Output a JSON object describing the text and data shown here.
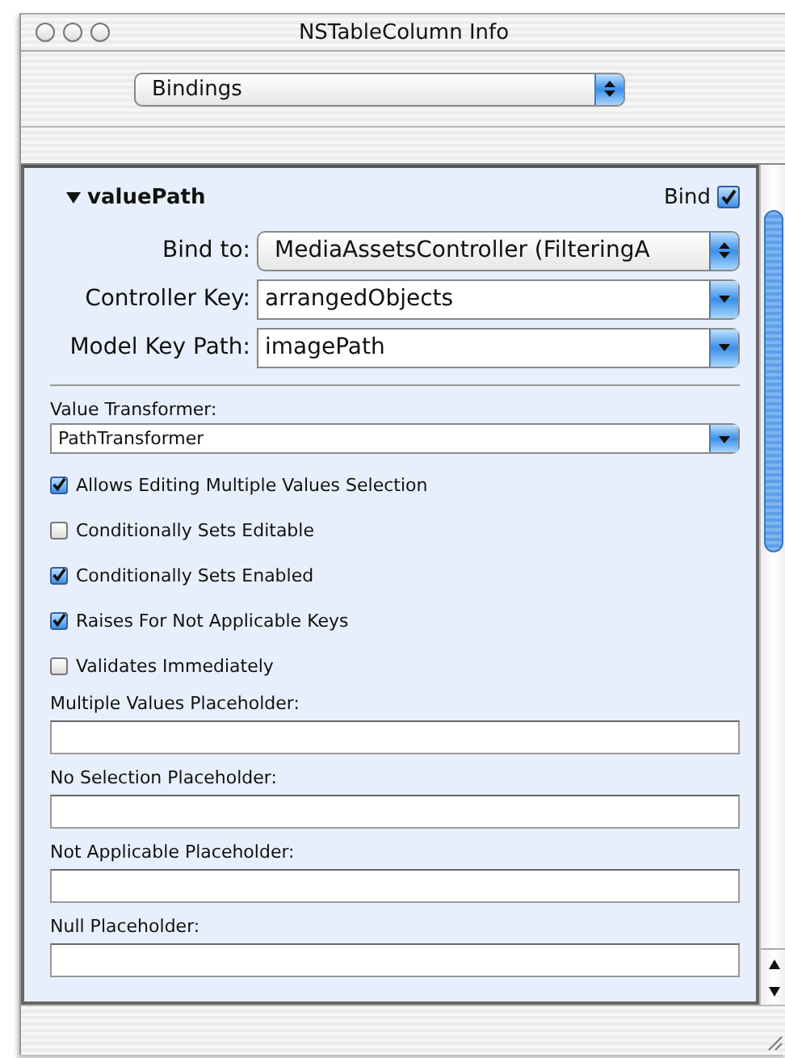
{
  "window": {
    "title": "NSTableColumn Info"
  },
  "inspector_popup": {
    "value": "Bindings"
  },
  "binding": {
    "name": "valuePath",
    "expanded": true,
    "bind_label": "Bind",
    "bind_checked": true,
    "rows": [
      {
        "kind": "popup",
        "label": "Bind to:",
        "value": "MediaAssetsController (FilteringA"
      },
      {
        "kind": "combo",
        "label": "Controller Key:",
        "value": "arrangedObjects"
      },
      {
        "kind": "combo",
        "label": "Model Key Path:",
        "value": "imagePath"
      }
    ],
    "value_transformer": {
      "label": "Value Transformer:",
      "value": "PathTransformer"
    },
    "options": [
      {
        "label": "Allows Editing Multiple Values Selection",
        "checked": true
      },
      {
        "label": "Conditionally Sets Editable",
        "checked": false
      },
      {
        "label": "Conditionally Sets Enabled",
        "checked": true
      },
      {
        "label": "Raises For Not Applicable Keys",
        "checked": true
      },
      {
        "label": "Validates Immediately",
        "checked": false
      }
    ],
    "placeholders": [
      {
        "label": "Multiple Values Placeholder:"
      },
      {
        "label": "No Selection Placeholder:"
      },
      {
        "label": "Not Applicable Placeholder:"
      },
      {
        "label": "Null Placeholder:"
      }
    ]
  }
}
